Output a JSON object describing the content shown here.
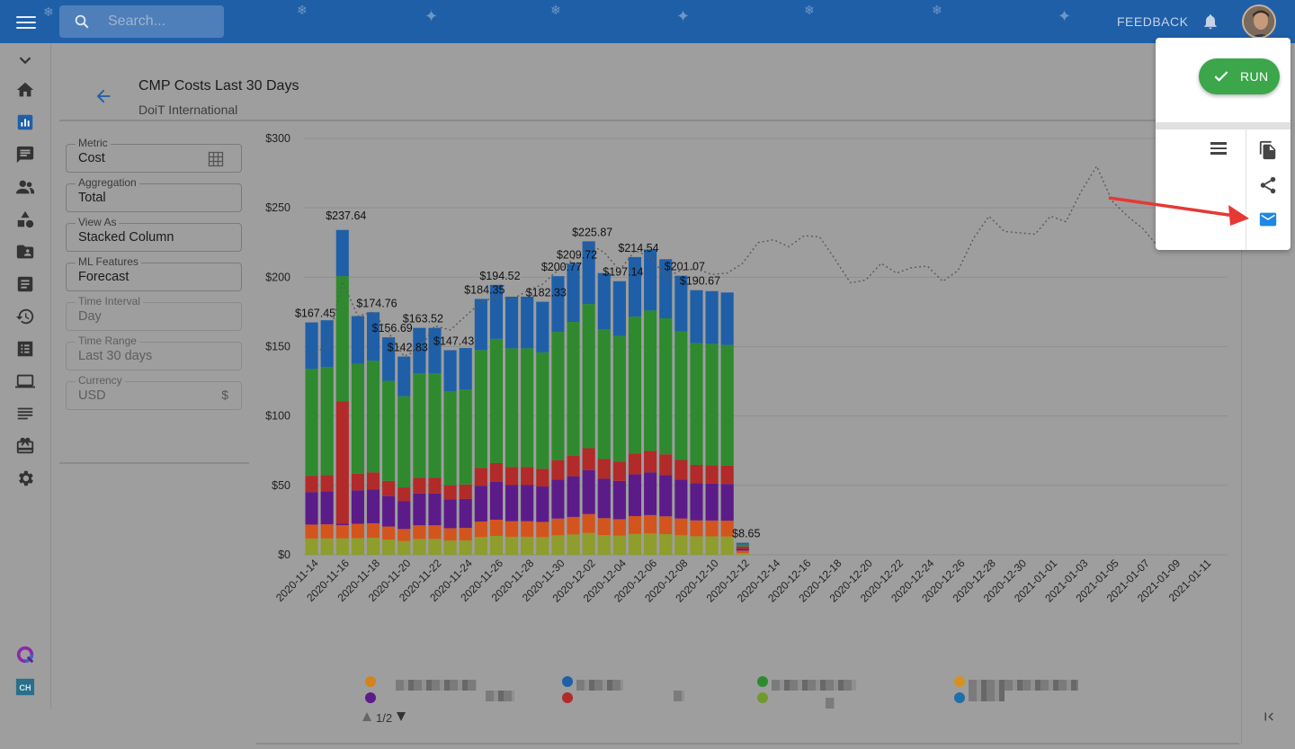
{
  "search": {
    "placeholder": "Search..."
  },
  "topbar": {
    "feedback_label": "FEEDBACK"
  },
  "report": {
    "title": "CMP Costs Last 30 Days",
    "subtitle": "DoiT International"
  },
  "fields": [
    {
      "label": "Metric",
      "value": "Cost"
    },
    {
      "label": "Aggregation",
      "value": "Total"
    },
    {
      "label": "View As",
      "value": "Stacked Column"
    },
    {
      "label": "ML Features",
      "value": "Forecast"
    },
    {
      "label": "Time Interval",
      "value": "Day"
    },
    {
      "label": "Time Range",
      "value": "Last 30 days"
    },
    {
      "label": "Currency",
      "value": "USD",
      "suffix": "$"
    }
  ],
  "popup": {
    "run_label": "RUN"
  },
  "colors": {
    "topbar": "#1f5fa8",
    "run": "#3ba64a",
    "blue": "#1f5fa8",
    "green": "#2f8a2f",
    "red": "#b22a2a",
    "purple": "#5b1c8a",
    "orange": "#d4541e",
    "olive": "#8e9d2b",
    "forecast": "#5a5a5a"
  },
  "legend_pager": "1/2",
  "chart_data": {
    "type": "bar",
    "stacked": true,
    "y_ticks": [
      "$300",
      "$250",
      "$200",
      "$150",
      "$100",
      "$50",
      "$0"
    ],
    "ylim": [
      0,
      300
    ],
    "x_tick_labels": [
      "2020-11-14",
      "2020-11-16",
      "2020-11-18",
      "2020-11-20",
      "2020-11-22",
      "2020-11-24",
      "2020-11-26",
      "2020-11-28",
      "2020-11-30",
      "2020-12-02",
      "2020-12-04",
      "2020-12-06",
      "2020-12-08",
      "2020-12-10",
      "2020-12-12",
      "2020-12-14",
      "2020-12-16",
      "2020-12-18",
      "2020-12-20",
      "2020-12-22",
      "2020-12-24",
      "2020-12-26",
      "2020-12-28",
      "2020-12-30",
      "2021-01-01",
      "2021-01-03",
      "2021-01-05",
      "2021-01-07",
      "2021-01-09",
      "2021-01-11"
    ],
    "bar_totals": [
      167.45,
      169,
      237.64,
      172,
      174.76,
      156.69,
      142.83,
      163.52,
      163.52,
      147.43,
      149,
      184.35,
      194.52,
      186,
      186,
      182.33,
      200.77,
      209.72,
      225.87,
      203,
      197.14,
      214.54,
      220,
      213,
      201.07,
      190.67,
      190,
      189,
      8.65
    ],
    "data_labels": [
      {
        "index": 0,
        "text": "$167.45"
      },
      {
        "index": 2,
        "text": "$237.64"
      },
      {
        "index": 4,
        "text": "$174.76"
      },
      {
        "index": 5,
        "text": "$156.69"
      },
      {
        "index": 6,
        "text": "$142.83"
      },
      {
        "index": 7,
        "text": "$163.52"
      },
      {
        "index": 9,
        "text": "$147.43"
      },
      {
        "index": 11,
        "text": "$184.35"
      },
      {
        "index": 12,
        "text": "$194.52"
      },
      {
        "index": 15,
        "text": "$182.33"
      },
      {
        "index": 16,
        "text": "$200.77"
      },
      {
        "index": 17,
        "text": "$209.72"
      },
      {
        "index": 18,
        "text": "$225.87"
      },
      {
        "index": 20,
        "text": "$197.14"
      },
      {
        "index": 21,
        "text": "$214.54"
      },
      {
        "index": 24,
        "text": "$201.07"
      },
      {
        "index": 25,
        "text": "$190.67"
      },
      {
        "index": 28,
        "text": "$8.65"
      }
    ],
    "series_colors": [
      "#8e9d2b",
      "#d4541e",
      "#5b1c8a",
      "#b22a2a",
      "#2f8a2f",
      "#1f5fa8"
    ],
    "forecast_line": [
      145,
      150,
      197,
      172,
      175,
      160,
      143,
      148,
      165,
      162,
      172,
      182,
      186,
      184,
      190,
      195,
      205,
      213,
      224,
      218,
      205,
      219,
      215,
      200,
      205,
      206,
      202,
      203,
      210,
      225,
      227,
      222,
      230,
      229,
      213,
      196,
      198,
      210,
      203,
      207,
      208,
      197,
      205,
      228,
      244,
      233,
      232,
      231,
      244,
      240,
      262,
      280,
      255,
      244,
      235,
      222,
      232,
      250,
      270,
      258
    ]
  }
}
